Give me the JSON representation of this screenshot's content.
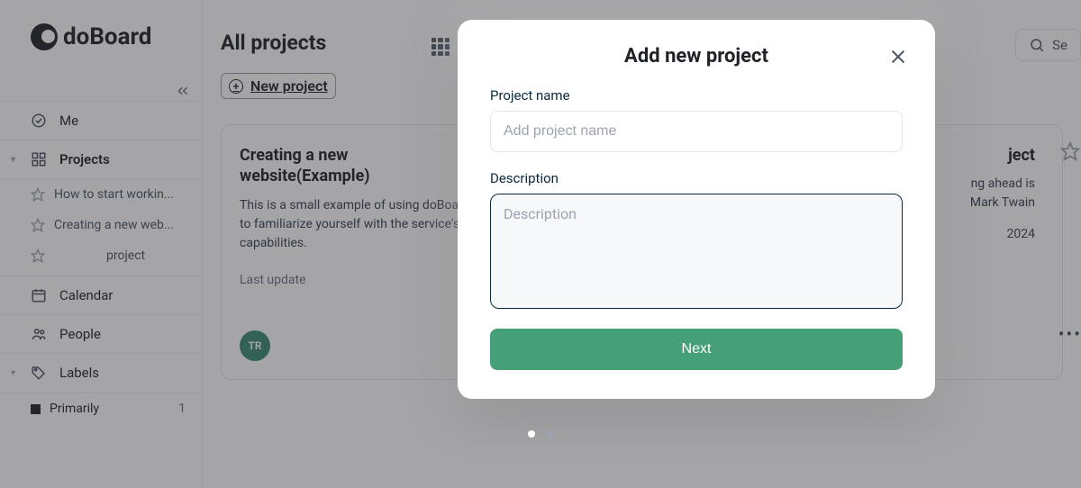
{
  "brand": "doBoard",
  "sidebar": {
    "me": "Me",
    "projects": "Projects",
    "sub": [
      "How to start workin...",
      "Creating a new web...",
      "project"
    ],
    "calendar": "Calendar",
    "people": "People",
    "labels": "Labels",
    "label_items": [
      {
        "name": "Primarily",
        "count": "1"
      }
    ]
  },
  "header": {
    "title": "All projects",
    "new_project": "New project",
    "search_placeholder": "Se"
  },
  "cards": {
    "left": {
      "title": "Creating a new website(Example)",
      "desc": "This is a small example of using doBoard to familiarize yourself with the service's capabilities.",
      "meta": "Last update",
      "avatar": "TR"
    },
    "right": {
      "title_suffix": "ject",
      "desc1": "ng ahead is",
      "desc2": "Mark Twain",
      "date": "2024"
    }
  },
  "modal": {
    "title": "Add new project",
    "name_label": "Project name",
    "name_placeholder": "Add project name",
    "desc_label": "Description",
    "desc_placeholder": "Description",
    "next": "Next"
  }
}
